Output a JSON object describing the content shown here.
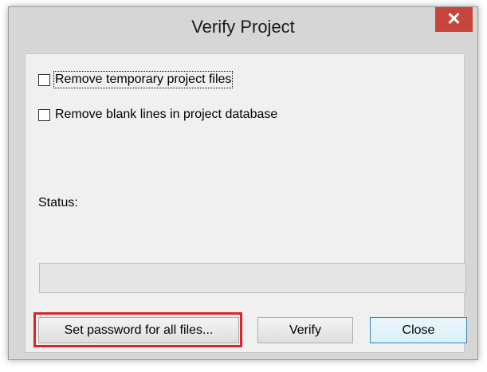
{
  "window": {
    "title": "Verify Project",
    "close_glyph": "✕"
  },
  "options": [
    {
      "label": "Remove temporary project files",
      "checked": false,
      "focused": true
    },
    {
      "label": "Remove blank lines in project database",
      "checked": false,
      "focused": false
    }
  ],
  "status": {
    "label": "Status:"
  },
  "progress": {
    "value": 0
  },
  "buttons": {
    "password_label": "Set password for all files...",
    "verify_label": "Verify",
    "close_label": "Close"
  },
  "colors": {
    "highlight": "#e0202a",
    "close_button": "#c7453b"
  }
}
